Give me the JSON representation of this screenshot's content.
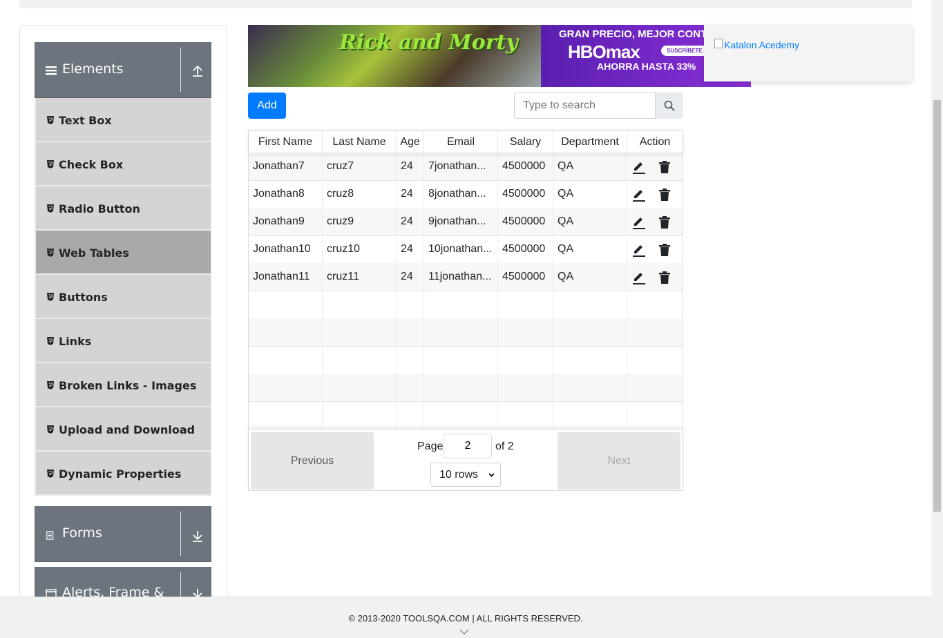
{
  "sidebar": {
    "groups": [
      {
        "title": "Elements",
        "icon": "hamburger-icon",
        "toggle": "collapse-up-icon"
      },
      {
        "title": "Forms",
        "icon": "document-icon",
        "toggle": "expand-down-icon"
      },
      {
        "title": "Alerts, Frame &",
        "icon": "window-icon",
        "toggle": "expand-down-icon"
      }
    ],
    "items": [
      {
        "label": "Text Box"
      },
      {
        "label": "Check Box"
      },
      {
        "label": "Radio Button"
      },
      {
        "label": "Web Tables",
        "active": true
      },
      {
        "label": "Buttons"
      },
      {
        "label": "Links"
      },
      {
        "label": "Broken Links - Images"
      },
      {
        "label": "Upload and Download"
      },
      {
        "label": "Dynamic Properties"
      }
    ]
  },
  "banner": {
    "logo_text": "Rick and Morty",
    "line1": "GRAN PRECIO, MEJOR CONT",
    "brand": "HBOmax",
    "badge": "SUSCRÍBETE A",
    "line3": "AHORRA HASTA 33%"
  },
  "ad": {
    "alt_text": "Katalon Acedemy"
  },
  "controls": {
    "add_label": "Add",
    "search_placeholder": "Type to search"
  },
  "table": {
    "columns": [
      "First Name",
      "Last Name",
      "Age",
      "Email",
      "Salary",
      "Department",
      "Action"
    ],
    "rows": [
      [
        "Jonathan7",
        "cruz7",
        "24",
        "7jonathan...",
        "4500000",
        "QA"
      ],
      [
        "Jonathan8",
        "cruz8",
        "24",
        "8jonathan...",
        "4500000",
        "QA"
      ],
      [
        "Jonathan9",
        "cruz9",
        "24",
        "9jonathan...",
        "4500000",
        "QA"
      ],
      [
        "Jonathan10",
        "cruz10",
        "24",
        "10jonathan...",
        "4500000",
        "QA"
      ],
      [
        "Jonathan11",
        "cruz11",
        "24",
        "11jonathan...",
        "4500000",
        "QA"
      ]
    ],
    "empty_rows": 5
  },
  "pagination": {
    "previous_label": "Previous",
    "next_label": "Next",
    "page_label": "Page",
    "page_value": "2",
    "of_label": "of 2",
    "rows_option": "10 rows"
  },
  "footer": {
    "copyright": "© 2013-2020 TOOLSQA.COM | ALL RIGHTS RESERVED."
  },
  "colors": {
    "primary": "#007bff",
    "group_header": "#6c757d",
    "menu_bg": "#d4d4d4",
    "menu_active": "#a9a9a9"
  }
}
